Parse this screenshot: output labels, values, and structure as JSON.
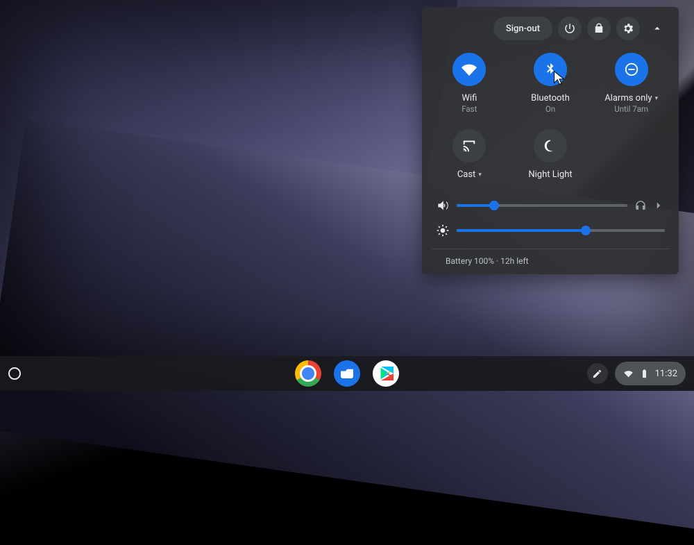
{
  "colors": {
    "accent": "#1a73e8",
    "panel": "#2d2f31",
    "muted": "#9aa0a6"
  },
  "header": {
    "signout_label": "Sign-out",
    "icons": {
      "power": "power-icon",
      "lock": "lock-icon",
      "settings": "gear-icon",
      "collapse": "chevron-up-icon"
    }
  },
  "tiles": [
    {
      "id": "wifi",
      "icon": "wifi-icon",
      "active": true,
      "title": "Wifi",
      "sub": "Fast",
      "dropdown": false
    },
    {
      "id": "bluetooth",
      "icon": "bluetooth-icon",
      "active": true,
      "title": "Bluetooth",
      "sub": "On",
      "dropdown": false
    },
    {
      "id": "dnd",
      "icon": "alarms-only-icon",
      "active": true,
      "title": "Alarms only",
      "sub": "Until 7am",
      "dropdown": true
    },
    {
      "id": "cast",
      "icon": "cast-icon",
      "active": false,
      "title": "Cast",
      "sub": "",
      "dropdown": true
    },
    {
      "id": "nightlight",
      "icon": "night-light-icon",
      "active": false,
      "title": "Night Light",
      "sub": "",
      "dropdown": false
    }
  ],
  "sliders": {
    "volume": {
      "icon": "volume-icon",
      "percent": 22,
      "trailing": [
        "headphones-icon",
        "chevron-right-icon"
      ]
    },
    "brightness": {
      "icon": "brightness-icon",
      "percent": 62
    }
  },
  "battery_line": "Battery 100% · 12h left",
  "shelf": {
    "apps": [
      {
        "id": "chrome",
        "name": "Chrome"
      },
      {
        "id": "files",
        "name": "Files"
      },
      {
        "id": "play",
        "name": "Play Store"
      }
    ],
    "stylus_icon": "stylus-icon",
    "tray": {
      "wifi_icon": "wifi-icon",
      "battery_icon": "battery-full-icon",
      "clock": "11:32"
    }
  }
}
